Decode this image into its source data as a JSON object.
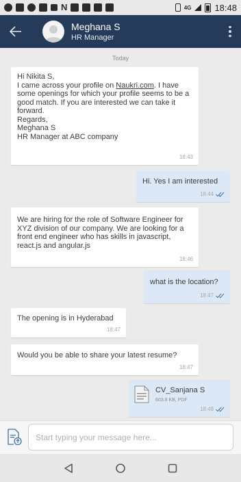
{
  "status_bar": {
    "time": "18:48",
    "network": "4G",
    "notification_icons": [
      "google-icon",
      "facebook-icon",
      "messenger-icon",
      "linkedin-icon",
      "naukri-icon",
      "n-icon",
      "outlook-icon",
      "outlook-icon",
      "linkedin-icon",
      "gmail-icon"
    ]
  },
  "header": {
    "contact_name": "Meghana S",
    "contact_role": "HR Manager",
    "bg_color": "#263b59"
  },
  "chat": {
    "day_label": "Today",
    "messages": [
      {
        "direction": "incoming",
        "greeting": "Hi Nikita S,",
        "text_before_link": "I came across your profile on ",
        "link": "Naukri.com",
        "text_after_link": ". I have some openings for which your profile seems to be a good match. If you are interested we can take it forward.",
        "signoff": "Regards,\nMeghana S\nHR Manager at ABC company",
        "time": "18:43"
      },
      {
        "direction": "outgoing",
        "text": "Hi. Yes I am interested",
        "time": "18:44"
      },
      {
        "direction": "incoming",
        "text": "We are hiring for the role of Software Engineer for XYZ division of our company. We are looking for a front end engineer who has skills in javascript, react.js and angular.js",
        "time": "18:46"
      },
      {
        "direction": "outgoing",
        "text": "what is the location?",
        "time": "18:47"
      },
      {
        "direction": "incoming",
        "text": "The opening is in Hyderabad",
        "time": "18:47"
      },
      {
        "direction": "incoming",
        "text": "Would you be able to share your latest resume?",
        "time": "18:47"
      },
      {
        "direction": "outgoing",
        "file_name": "CV_Sanjana S",
        "file_info": "603.8 KB, PDF",
        "time": "18:48"
      }
    ]
  },
  "composer": {
    "placeholder": "Start typing your message here..."
  },
  "colors": {
    "incoming_bubble": "#ffffff",
    "outgoing_bubble": "#dce8f5",
    "read_ticks": "#3f6fa8"
  }
}
